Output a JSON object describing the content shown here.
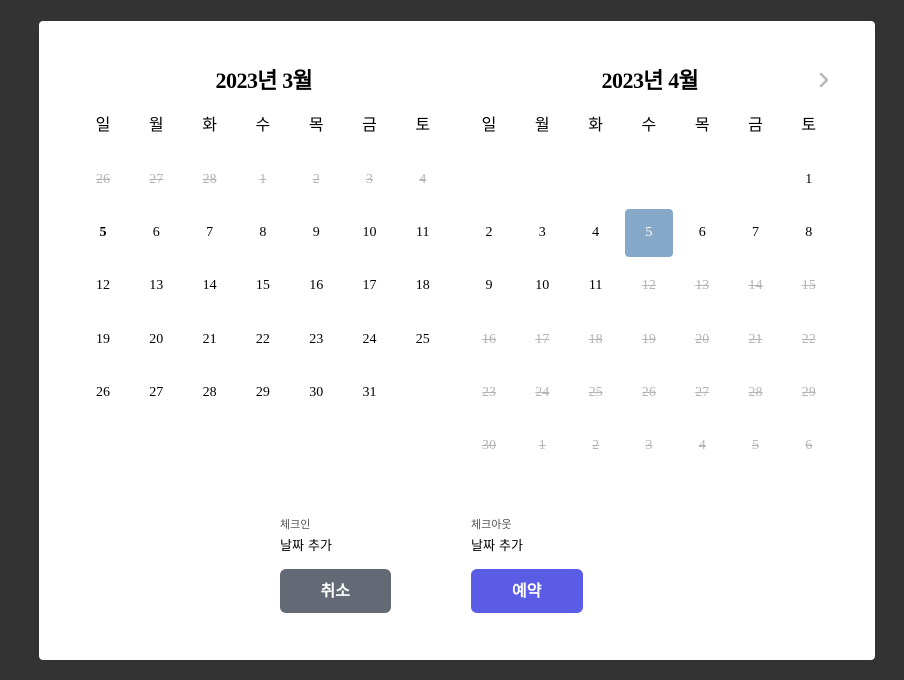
{
  "weekdays": [
    "일",
    "월",
    "화",
    "수",
    "목",
    "금",
    "토"
  ],
  "calendars": [
    {
      "title": "2023년 3월",
      "weeks": [
        [
          {
            "d": "26",
            "s": "disabled"
          },
          {
            "d": "27",
            "s": "disabled"
          },
          {
            "d": "28",
            "s": "disabled"
          },
          {
            "d": "1",
            "s": "disabled"
          },
          {
            "d": "2",
            "s": "disabled"
          },
          {
            "d": "3",
            "s": "disabled"
          },
          {
            "d": "4",
            "s": "disabled"
          }
        ],
        [
          {
            "d": "5",
            "s": "today"
          },
          {
            "d": "6",
            "s": ""
          },
          {
            "d": "7",
            "s": ""
          },
          {
            "d": "8",
            "s": ""
          },
          {
            "d": "9",
            "s": ""
          },
          {
            "d": "10",
            "s": ""
          },
          {
            "d": "11",
            "s": ""
          }
        ],
        [
          {
            "d": "12",
            "s": ""
          },
          {
            "d": "13",
            "s": ""
          },
          {
            "d": "14",
            "s": ""
          },
          {
            "d": "15",
            "s": ""
          },
          {
            "d": "16",
            "s": ""
          },
          {
            "d": "17",
            "s": ""
          },
          {
            "d": "18",
            "s": ""
          }
        ],
        [
          {
            "d": "19",
            "s": ""
          },
          {
            "d": "20",
            "s": ""
          },
          {
            "d": "21",
            "s": ""
          },
          {
            "d": "22",
            "s": ""
          },
          {
            "d": "23",
            "s": ""
          },
          {
            "d": "24",
            "s": ""
          },
          {
            "d": "25",
            "s": ""
          }
        ],
        [
          {
            "d": "26",
            "s": ""
          },
          {
            "d": "27",
            "s": ""
          },
          {
            "d": "28",
            "s": ""
          },
          {
            "d": "29",
            "s": ""
          },
          {
            "d": "30",
            "s": ""
          },
          {
            "d": "31",
            "s": ""
          },
          null
        ]
      ]
    },
    {
      "title": "2023년 4월",
      "weeks": [
        [
          null,
          null,
          null,
          null,
          null,
          null,
          {
            "d": "1",
            "s": ""
          }
        ],
        [
          {
            "d": "2",
            "s": ""
          },
          {
            "d": "3",
            "s": ""
          },
          {
            "d": "4",
            "s": ""
          },
          {
            "d": "5",
            "s": "selected"
          },
          {
            "d": "6",
            "s": ""
          },
          {
            "d": "7",
            "s": ""
          },
          {
            "d": "8",
            "s": ""
          }
        ],
        [
          {
            "d": "9",
            "s": ""
          },
          {
            "d": "10",
            "s": ""
          },
          {
            "d": "11",
            "s": ""
          },
          {
            "d": "12",
            "s": "disabled"
          },
          {
            "d": "13",
            "s": "disabled"
          },
          {
            "d": "14",
            "s": "disabled"
          },
          {
            "d": "15",
            "s": "disabled"
          }
        ],
        [
          {
            "d": "16",
            "s": "disabled"
          },
          {
            "d": "17",
            "s": "disabled"
          },
          {
            "d": "18",
            "s": "disabled"
          },
          {
            "d": "19",
            "s": "disabled"
          },
          {
            "d": "20",
            "s": "disabled"
          },
          {
            "d": "21",
            "s": "disabled"
          },
          {
            "d": "22",
            "s": "disabled"
          }
        ],
        [
          {
            "d": "23",
            "s": "disabled"
          },
          {
            "d": "24",
            "s": "disabled"
          },
          {
            "d": "25",
            "s": "disabled"
          },
          {
            "d": "26",
            "s": "disabled"
          },
          {
            "d": "27",
            "s": "disabled"
          },
          {
            "d": "28",
            "s": "disabled"
          },
          {
            "d": "29",
            "s": "disabled"
          }
        ],
        [
          {
            "d": "30",
            "s": "disabled"
          },
          {
            "d": "1",
            "s": "disabled"
          },
          {
            "d": "2",
            "s": "disabled"
          },
          {
            "d": "3",
            "s": "disabled"
          },
          {
            "d": "4",
            "s": "disabled"
          },
          {
            "d": "5",
            "s": "disabled"
          },
          {
            "d": "6",
            "s": "disabled"
          }
        ]
      ]
    }
  ],
  "next_icon": "chevron-right-icon",
  "checkin": {
    "label": "체크인",
    "value": "날짜 추가"
  },
  "checkout": {
    "label": "체크아웃",
    "value": "날짜 추가"
  },
  "buttons": {
    "cancel": "취소",
    "reserve": "예약"
  },
  "colors": {
    "selected": "#87a9c9",
    "reserve": "#5b5ce5",
    "cancel": "#646a75",
    "disabled": "#b5b5b5"
  }
}
